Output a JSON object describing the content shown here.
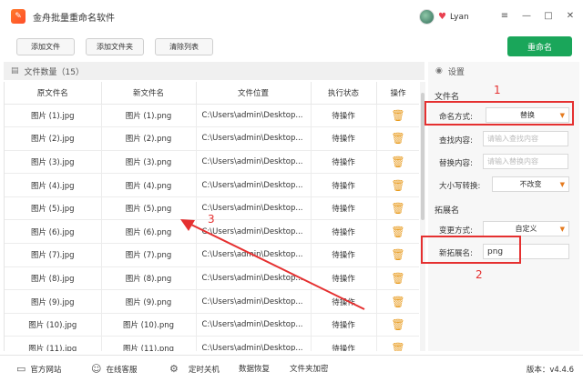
{
  "app": {
    "title": "金舟批量重命名软件",
    "username": "Lyan"
  },
  "window_controls": {
    "menu": "≡",
    "minimize": "—",
    "maximize": "□",
    "close": "✕"
  },
  "toolbar": {
    "add_file": "添加文件",
    "add_folder": "添加文件夹",
    "clear_list": "清除列表",
    "rename": "重命名"
  },
  "list": {
    "header": "文件数量（15）",
    "columns": [
      "原文件名",
      "新文件名",
      "文件位置",
      "执行状态",
      "操作"
    ],
    "rows": [
      {
        "orig": "图片 (1).jpg",
        "new": "图片 (1).png",
        "path": "C:\\Users\\admin\\Desktop...",
        "status": "待操作"
      },
      {
        "orig": "图片 (2).jpg",
        "new": "图片 (2).png",
        "path": "C:\\Users\\admin\\Desktop...",
        "status": "待操作"
      },
      {
        "orig": "图片 (3).jpg",
        "new": "图片 (3).png",
        "path": "C:\\Users\\admin\\Desktop...",
        "status": "待操作"
      },
      {
        "orig": "图片 (4).jpg",
        "new": "图片 (4).png",
        "path": "C:\\Users\\admin\\Desktop...",
        "status": "待操作"
      },
      {
        "orig": "图片 (5).jpg",
        "new": "图片 (5).png",
        "path": "C:\\Users\\admin\\Desktop...",
        "status": "待操作"
      },
      {
        "orig": "图片 (6).jpg",
        "new": "图片 (6).png",
        "path": "C:\\Users\\admin\\Desktop...",
        "status": "待操作"
      },
      {
        "orig": "图片 (7).jpg",
        "new": "图片 (7).png",
        "path": "C:\\Users\\admin\\Desktop...",
        "status": "待操作"
      },
      {
        "orig": "图片 (8).jpg",
        "new": "图片 (8).png",
        "path": "C:\\Users\\admin\\Desktop...",
        "status": "待操作"
      },
      {
        "orig": "图片 (9).jpg",
        "new": "图片 (9).png",
        "path": "C:\\Users\\admin\\Desktop...",
        "status": "待操作"
      },
      {
        "orig": "图片 (10).jpg",
        "new": "图片 (10).png",
        "path": "C:\\Users\\admin\\Desktop...",
        "status": "待操作"
      },
      {
        "orig": "图片 (11).jpg",
        "new": "图片 (11).png",
        "path": "C:\\Users\\admin\\Desktop...",
        "status": "待操作"
      }
    ]
  },
  "settings": {
    "header": "设置",
    "filename_section": "文件名",
    "rename_mode_label": "命名方式:",
    "rename_mode_value": "替换",
    "find_label": "查找内容:",
    "find_placeholder": "请输入查找内容",
    "replace_label": "替换内容:",
    "replace_placeholder": "请输入替换内容",
    "case_label": "大小写转换:",
    "case_value": "不改变",
    "ext_section": "拓展名",
    "change_mode_label": "变更方式:",
    "change_mode_value": "自定义",
    "new_ext_label": "新拓展名:",
    "new_ext_value": "png"
  },
  "annotations": {
    "n1": "1",
    "n2": "2",
    "n3": "3"
  },
  "footer": {
    "website": "官方网站",
    "support": "在线客服",
    "shutdown": "定时关机",
    "recovery": "数据恢复",
    "encrypt": "文件夹加密",
    "version": "版本：v4.4.6"
  },
  "colors": {
    "accent": "#1aa65a",
    "annotation": "#e53030",
    "trash": "#e89a1c"
  }
}
